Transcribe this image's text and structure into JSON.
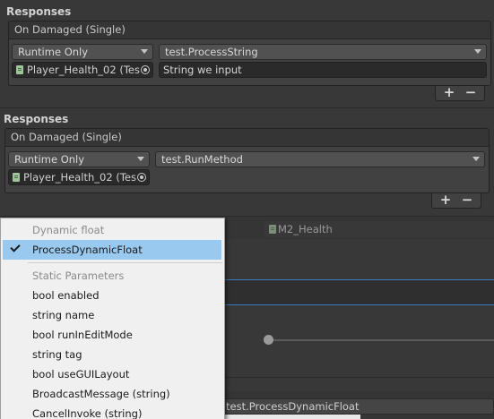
{
  "panel1": {
    "title": "Responses",
    "event_header": "On Damaged (Single)",
    "mode": "Runtime Only",
    "method": "test.ProcessString",
    "object": "Player_Health_02 (Tes",
    "argument": "String we input",
    "add_label": "+",
    "remove_label": "−"
  },
  "panel2": {
    "title": "Responses",
    "event_header": "On Damaged (Single)",
    "mode": "Runtime Only",
    "method": "test.RunMethod",
    "object": "Player_Health_02 (Tes",
    "add_label": "+",
    "remove_label": "−"
  },
  "background": {
    "field_label": "M2_Health",
    "bottom_method": "test.ProcessDynamicFloat"
  },
  "menu": {
    "dynamic_header": "Dynamic float",
    "dynamic_item": "ProcessDynamicFloat",
    "static_header": "Static Parameters",
    "items": [
      "bool enabled",
      "string name",
      "bool runInEditMode",
      "string tag",
      "bool useGUILayout",
      "BroadcastMessage (string)",
      "CancelInvoke (string)"
    ]
  },
  "colors": {
    "editor_bg": "#383838",
    "menu_bg": "#f0f0f0",
    "menu_selected": "#99c9ef",
    "focus_line": "#3a79bb"
  }
}
